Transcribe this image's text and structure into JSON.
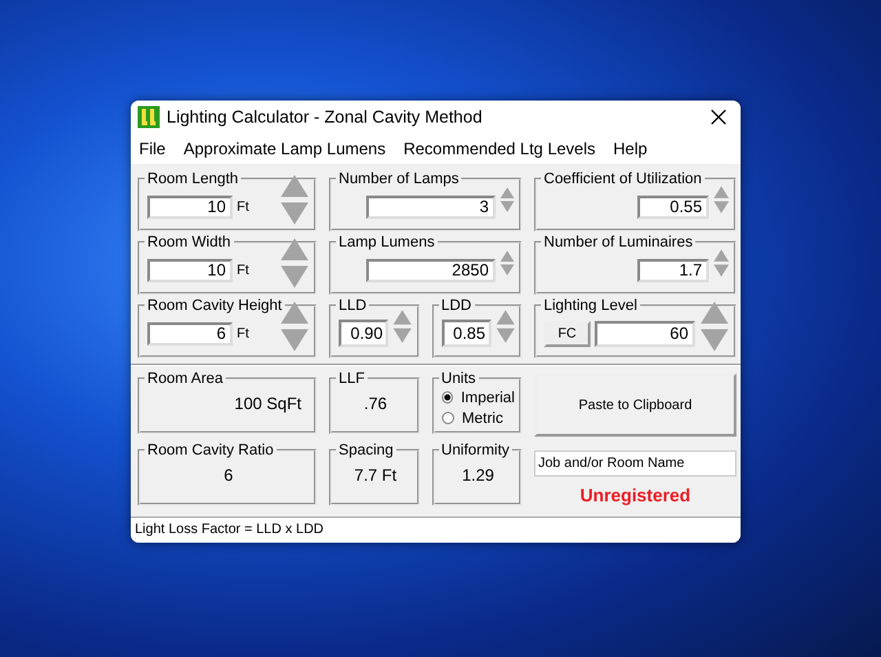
{
  "window": {
    "title": "Lighting Calculator - Zonal Cavity Method"
  },
  "menu": [
    "File",
    "Approximate Lamp Lumens",
    "Recommended Ltg Levels",
    "Help"
  ],
  "input_rows": [
    [
      {
        "kind": "spin",
        "label": "Room Length",
        "value": "10",
        "unit": "Ft"
      },
      {
        "kind": "spin",
        "label": "Number of Lamps",
        "value": "3"
      },
      {
        "kind": "spin",
        "label": "Coefficient of Utilization",
        "value": "0.55"
      }
    ],
    [
      {
        "kind": "spin",
        "label": "Room Width",
        "value": "10",
        "unit": "Ft"
      },
      {
        "kind": "spin",
        "label": "Lamp Lumens",
        "value": "2850"
      },
      {
        "kind": "spin",
        "label": "Number of Luminaires",
        "value": "1.7"
      }
    ],
    [
      {
        "kind": "spin",
        "label": "Room Cavity Height",
        "value": "6",
        "unit": "Ft"
      },
      {
        "kind": "pair",
        "items": [
          {
            "label": "LLD",
            "value": "0.90"
          },
          {
            "label": "LDD",
            "value": "0.85"
          }
        ]
      },
      {
        "kind": "level",
        "label": "Lighting Level",
        "button": "FC",
        "value": "60"
      }
    ]
  ],
  "results": {
    "room_area": {
      "label": "Room Area",
      "value": "100 SqFt"
    },
    "llf": {
      "label": "LLF",
      "value": ".76"
    },
    "units": {
      "label": "Units",
      "options": [
        {
          "label": "Imperial",
          "selected": true
        },
        {
          "label": "Metric",
          "selected": false
        }
      ]
    },
    "paste_button": "Paste to Clipboard",
    "room_cavity_ratio": {
      "label": "Room Cavity Ratio",
      "value": "6"
    },
    "spacing": {
      "label": "Spacing",
      "value": "7.7 Ft"
    },
    "uniformity": {
      "label": "Uniformity",
      "value": "1.29"
    },
    "job_name": {
      "placeholder": "Job and/or Room Name"
    },
    "registration": "Unregistered"
  },
  "status_bar": "Light Loss Factor = LLD x LDD"
}
